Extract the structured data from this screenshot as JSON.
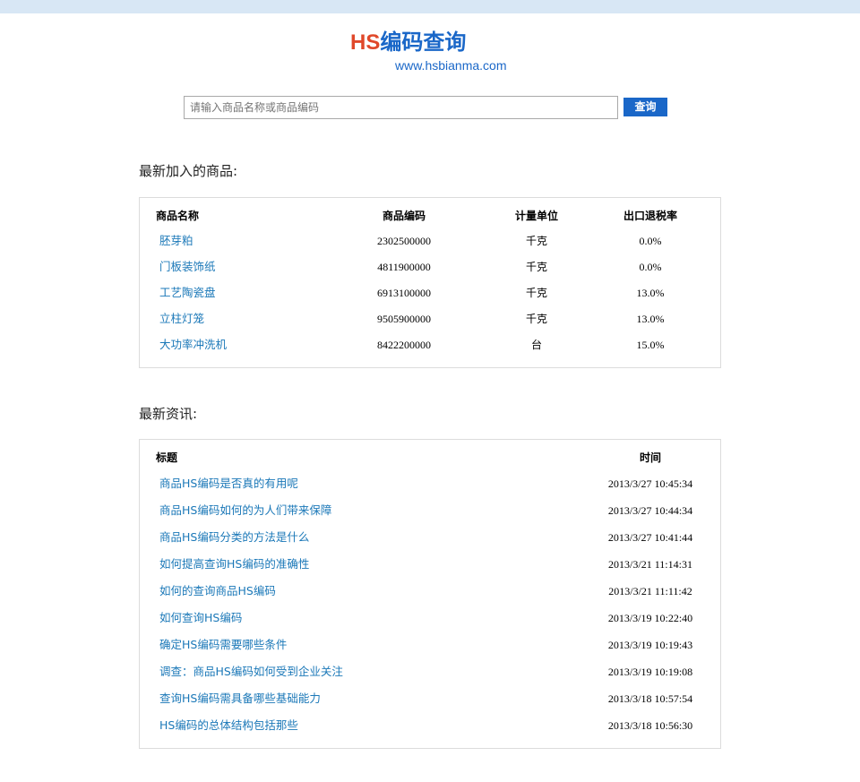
{
  "header": {
    "logo_hs": "HS",
    "logo_cn": "编码查询",
    "url": "www.hsbianma.com"
  },
  "search": {
    "placeholder": "请输入商品名称或商品编码",
    "button_label": "查询"
  },
  "products": {
    "heading": "最新加入的商品:",
    "columns": [
      "商品名称",
      "商品编码",
      "计量单位",
      "出口退税率"
    ],
    "rows": [
      {
        "name": "胚芽粕",
        "code": "2302500000",
        "unit": "千克",
        "rate": "0.0%"
      },
      {
        "name": "门板装饰纸",
        "code": "4811900000",
        "unit": "千克",
        "rate": "0.0%"
      },
      {
        "name": "工艺陶瓷盘",
        "code": "6913100000",
        "unit": "千克",
        "rate": "13.0%"
      },
      {
        "name": "立柱灯笼",
        "code": "9505900000",
        "unit": "千克",
        "rate": "13.0%"
      },
      {
        "name": "大功率冲洗机",
        "code": "8422200000",
        "unit": "台",
        "rate": "15.0%"
      }
    ]
  },
  "news": {
    "heading": "最新资讯:",
    "columns": [
      "标题",
      "时间"
    ],
    "rows": [
      {
        "title": "商品HS编码是否真的有用呢",
        "time": "2013/3/27 10:45:34"
      },
      {
        "title": "商品HS编码如何的为人们带来保障",
        "time": "2013/3/27 10:44:34"
      },
      {
        "title": "商品HS编码分类的方法是什么",
        "time": "2013/3/27 10:41:44"
      },
      {
        "title": "如何提高查询HS编码的准确性",
        "time": "2013/3/21 11:14:31"
      },
      {
        "title": "如何的查询商品HS编码",
        "time": "2013/3/21 11:11:42"
      },
      {
        "title": "如何查询HS编码",
        "time": "2013/3/19 10:22:40"
      },
      {
        "title": "确定HS编码需要哪些条件",
        "time": "2013/3/19 10:19:43"
      },
      {
        "title": "调查：商品HS编码如何受到企业关注",
        "time": "2013/3/19 10:19:08"
      },
      {
        "title": "查询HS编码需具备哪些基础能力",
        "time": "2013/3/18 10:57:54"
      },
      {
        "title": "HS编码的总体结构包括那些",
        "time": "2013/3/18 10:56:30"
      }
    ]
  }
}
